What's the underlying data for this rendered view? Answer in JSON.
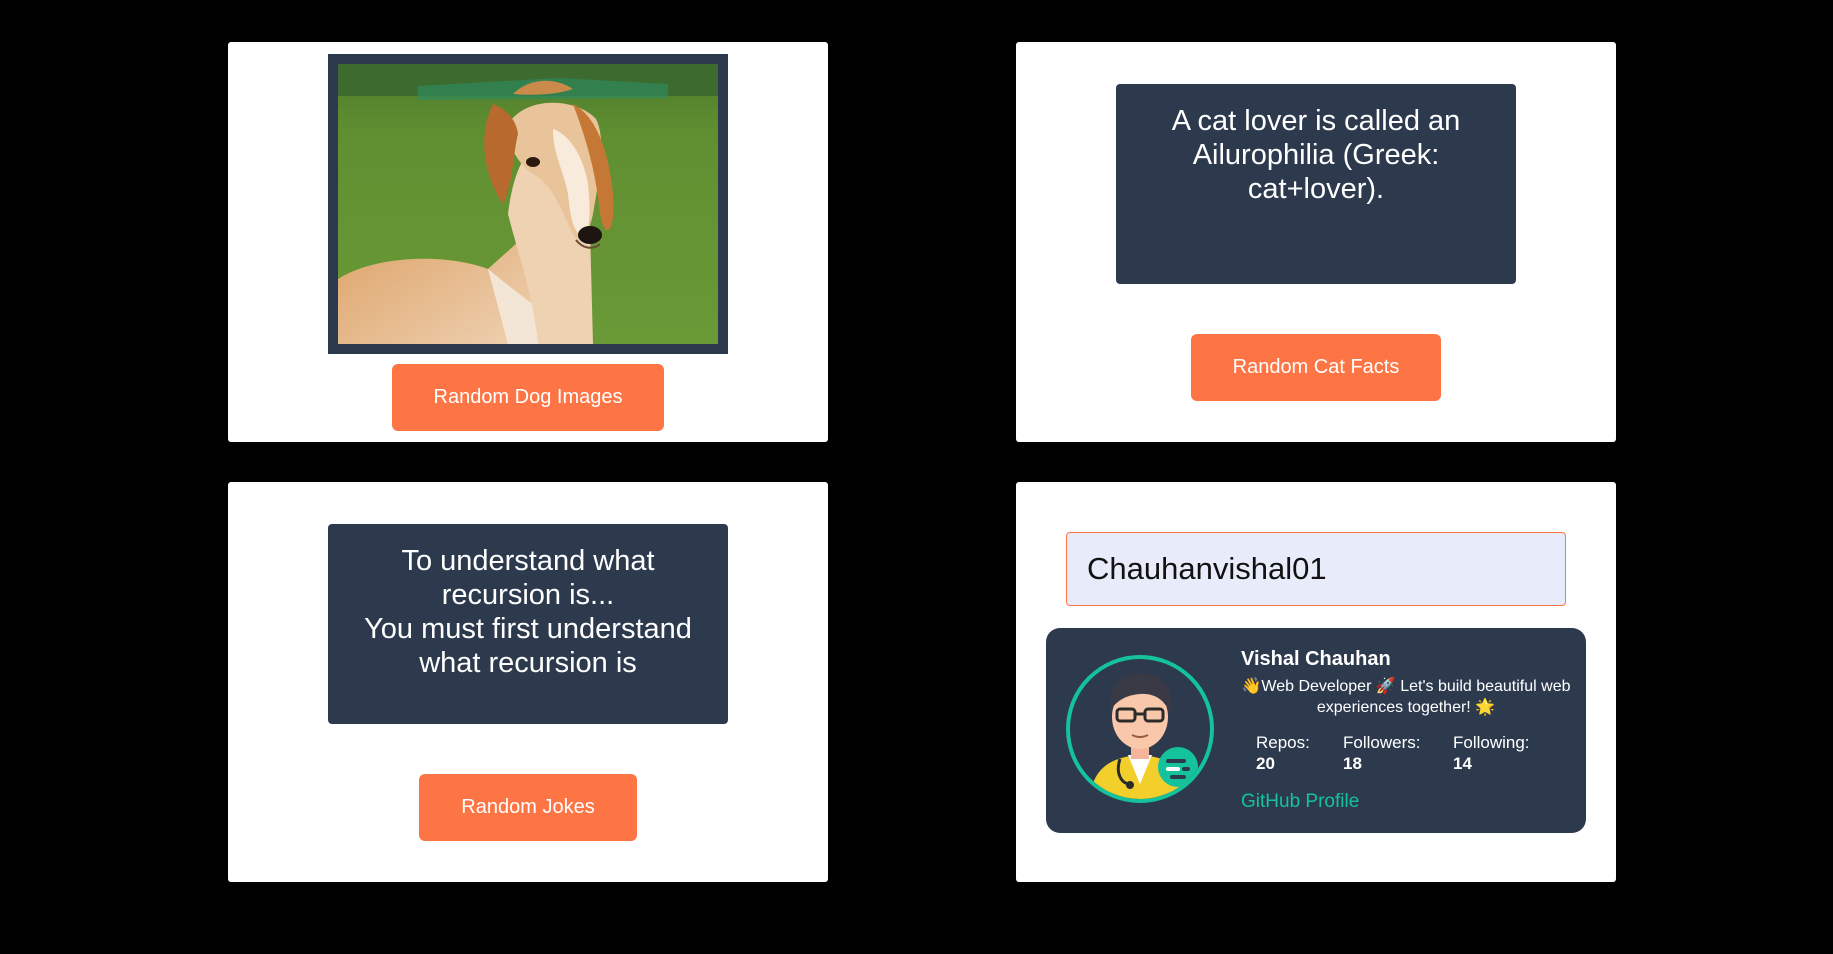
{
  "dog_card": {
    "image_alt": "dog photo",
    "button_label": "Random Dog Images"
  },
  "cat_card": {
    "fact": "A cat lover is called an Ailurophilia (Greek: cat+lover).",
    "button_label": "Random Cat Facts"
  },
  "joke_card": {
    "joke_line_1": "To understand what recursion is...",
    "joke_line_2": "You must first understand what recursion is",
    "button_label": "Random Jokes"
  },
  "github_card": {
    "search_value": "Chauhanvishal01",
    "profile": {
      "name": "Vishal Chauhan",
      "bio": "👋Web Developer 🚀 Let's build beautiful web experiences together! 🌟",
      "repos_label": "Repos:",
      "repos": "20",
      "followers_label": "Followers:",
      "followers": "18",
      "following_label": "Following:",
      "following": "14",
      "link_label": "GitHub Profile"
    }
  },
  "colors": {
    "background": "#000000",
    "card": "#ffffff",
    "accent_button": "#fe7545",
    "dark_panel": "#2d3a4e",
    "link_teal": "#14c29b",
    "input_bg": "#e8ebfa"
  }
}
